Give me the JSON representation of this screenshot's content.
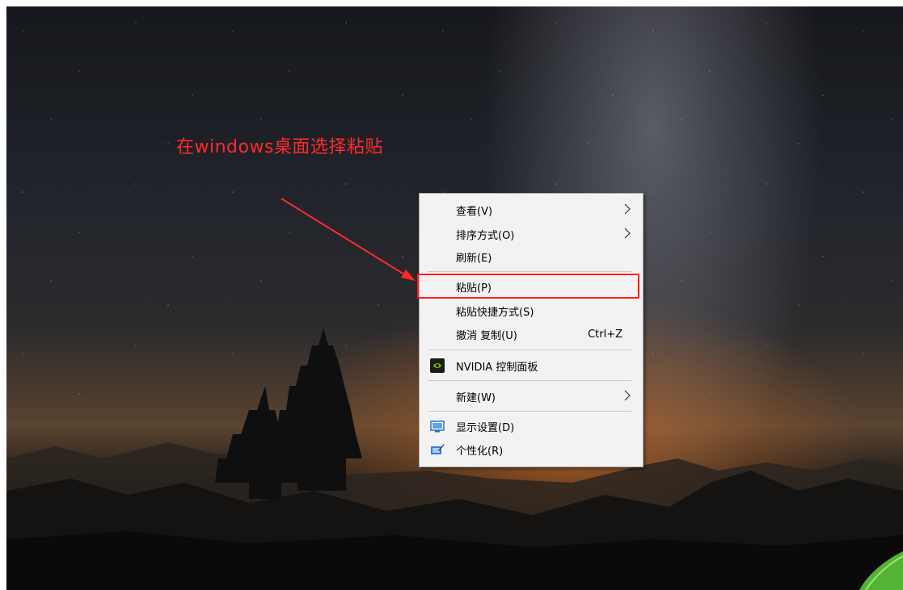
{
  "annotation": {
    "text": "在windows桌面选择粘贴",
    "color": "#ff2a2a"
  },
  "context_menu": {
    "items": [
      {
        "label": "查看(V)",
        "has_submenu": true
      },
      {
        "label": "排序方式(O)",
        "has_submenu": true
      },
      {
        "label": "刷新(E)",
        "has_submenu": false
      },
      {
        "label": "粘贴(P)",
        "has_submenu": false,
        "highlighted": true
      },
      {
        "label": "粘贴快捷方式(S)",
        "has_submenu": false
      },
      {
        "label": "撤消 复制(U)",
        "shortcut": "Ctrl+Z",
        "has_submenu": false
      },
      {
        "label": "NVIDIA 控制面板",
        "icon": "nvidia-icon",
        "has_submenu": false
      },
      {
        "label": "新建(W)",
        "has_submenu": true
      },
      {
        "label": "显示设置(D)",
        "icon": "display-settings-icon",
        "has_submenu": false
      },
      {
        "label": "个性化(R)",
        "icon": "personalize-icon",
        "has_submenu": false
      }
    ]
  },
  "highlight_color": "#ff1e1e"
}
